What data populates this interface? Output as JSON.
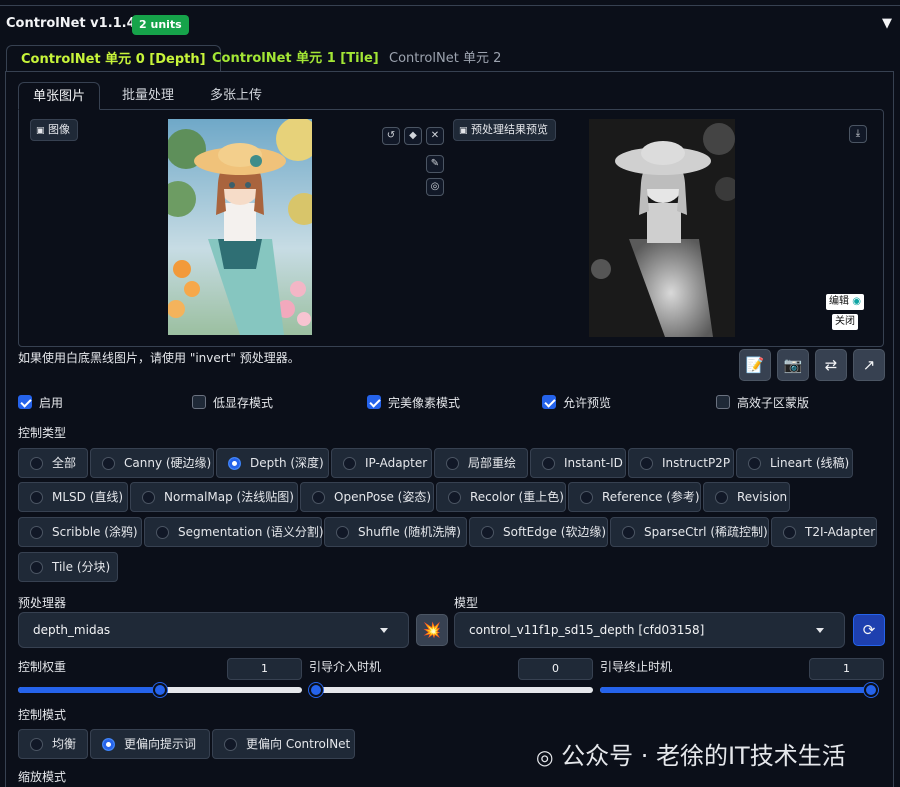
{
  "header": {
    "title": "ControlNet v1.1.449",
    "units_badge": "2 units",
    "collapse_icon": "triangle-down-icon"
  },
  "unit_tabs": [
    {
      "label": "ControlNet 单元 0 [Depth]",
      "active": true
    },
    {
      "label": "ControlNet 单元 1 [Tile]",
      "active": false
    },
    {
      "label": "ControlNet 单元 2",
      "active": false
    }
  ],
  "input_tabs": [
    {
      "label": "单张图片",
      "active": true
    },
    {
      "label": "批量处理",
      "active": false
    },
    {
      "label": "多张上传",
      "active": false
    }
  ],
  "image_panel": {
    "label": "图像"
  },
  "preview_panel": {
    "label": "预处理结果预览",
    "edit_label": "编辑",
    "close_label": "关闭"
  },
  "hint_text": "如果使用白底黑线图片，请使用 \"invert\" 预处理器。",
  "checkboxes": [
    {
      "label": "启用",
      "checked": true
    },
    {
      "label": "低显存模式",
      "checked": false
    },
    {
      "label": "完美像素模式",
      "checked": true
    },
    {
      "label": "允许预览",
      "checked": true
    },
    {
      "label": "高效子区蒙版",
      "checked": false
    }
  ],
  "control_type": {
    "label": "控制类型",
    "options": [
      "全部",
      "Canny (硬边缘)",
      "Depth (深度)",
      "IP-Adapter",
      "局部重绘",
      "Instant-ID",
      "InstructP2P",
      "Lineart (线稿)",
      "MLSD (直线)",
      "NormalMap (法线贴图)",
      "OpenPose (姿态)",
      "Recolor (重上色)",
      "Reference (参考)",
      "Revision",
      "Scribble (涂鸦)",
      "Segmentation (语义分割)",
      "Shuffle (随机洗牌)",
      "SoftEdge (软边缘)",
      "SparseCtrl (稀疏控制)",
      "T2I-Adapter",
      "Tile (分块)"
    ],
    "selected": "Depth (深度)"
  },
  "preprocessor": {
    "label": "预处理器",
    "value": "depth_midas"
  },
  "model": {
    "label": "模型",
    "value": "control_v11f1p_sd15_depth [cfd03158]"
  },
  "sliders": [
    {
      "label": "控制权重",
      "value": "1",
      "fraction": 0.5
    },
    {
      "label": "引导介入时机",
      "value": "0",
      "fraction": 0.0
    },
    {
      "label": "引导终止时机",
      "value": "1",
      "fraction": 1.0
    }
  ],
  "control_mode": {
    "label": "控制模式",
    "options": [
      "均衡",
      "更偏向提示词",
      "更偏向 ControlNet"
    ],
    "selected": "更偏向提示词"
  },
  "resize_mode": {
    "label": "缩放模式"
  },
  "watermark": "公众号 · 老徐的IT技术生活"
}
